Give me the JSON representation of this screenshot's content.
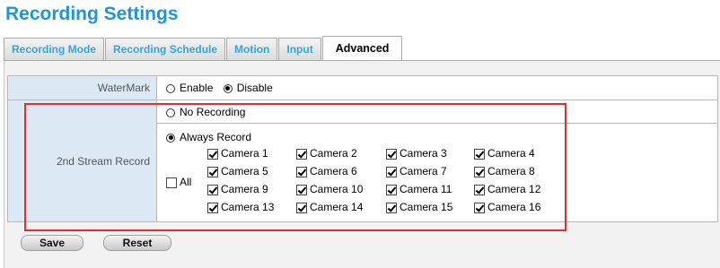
{
  "page_title": "Recording Settings",
  "tabs": [
    {
      "label": "Recording Mode",
      "active": false
    },
    {
      "label": "Recording Schedule",
      "active": false
    },
    {
      "label": "Motion",
      "active": false
    },
    {
      "label": "Input",
      "active": false
    },
    {
      "label": "Advanced",
      "active": true
    }
  ],
  "watermark": {
    "label": "WaterMark",
    "options": [
      {
        "label": "Enable",
        "selected": false
      },
      {
        "label": "Disable",
        "selected": true
      }
    ]
  },
  "stream_record": {
    "label": "2nd Stream Record",
    "options": [
      {
        "label": "No Recording",
        "selected": false
      },
      {
        "label": "Always Record",
        "selected": true
      }
    ],
    "all_label": "All",
    "all_checked": false,
    "cameras": [
      {
        "label": "Camera 1",
        "checked": true
      },
      {
        "label": "Camera 2",
        "checked": true
      },
      {
        "label": "Camera 3",
        "checked": true
      },
      {
        "label": "Camera 4",
        "checked": true
      },
      {
        "label": "Camera 5",
        "checked": true
      },
      {
        "label": "Camera 6",
        "checked": true
      },
      {
        "label": "Camera 7",
        "checked": true
      },
      {
        "label": "Camera 8",
        "checked": true
      },
      {
        "label": "Camera 9",
        "checked": true
      },
      {
        "label": "Camera 10",
        "checked": true
      },
      {
        "label": "Camera 11",
        "checked": true
      },
      {
        "label": "Camera 12",
        "checked": true
      },
      {
        "label": "Camera 13",
        "checked": true
      },
      {
        "label": "Camera 14",
        "checked": true
      },
      {
        "label": "Camera 15",
        "checked": true
      },
      {
        "label": "Camera 16",
        "checked": true
      }
    ]
  },
  "buttons": {
    "save": "Save",
    "reset": "Reset"
  },
  "colors": {
    "title": "#1e96d4",
    "tab_text": "#33a5dd",
    "label_bg": "#dce9f5",
    "highlight_box": "#e52d2d"
  }
}
